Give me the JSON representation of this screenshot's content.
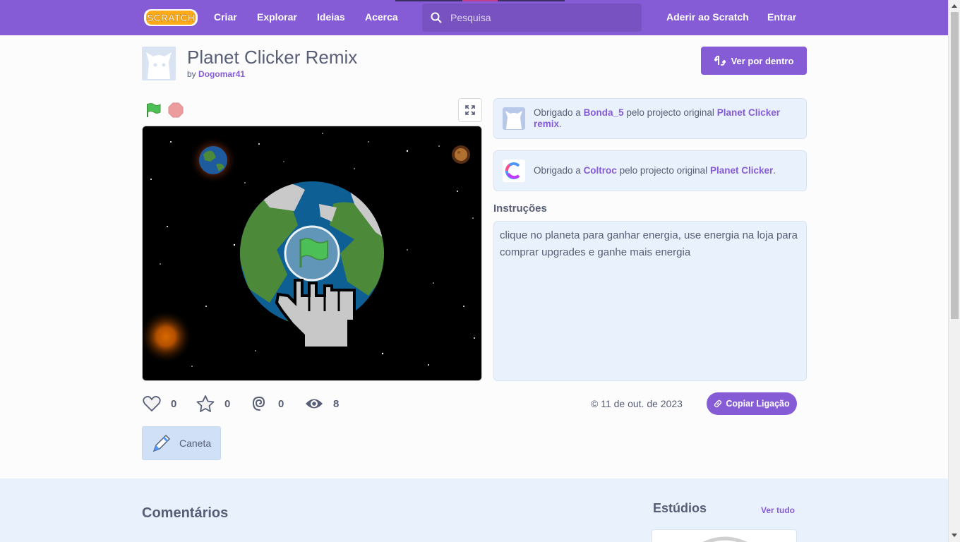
{
  "nav": {
    "logo_text": "SCRATCH",
    "links": [
      "Criar",
      "Explorar",
      "Ideias",
      "Acerca"
    ],
    "search_placeholder": "Pesquisa",
    "join": "Aderir ao Scratch",
    "signin": "Entrar"
  },
  "project": {
    "title": "Planet Clicker Remix",
    "by_prefix": "by",
    "author": "Dogomar41",
    "see_inside": "Ver por dentro"
  },
  "credits": [
    {
      "prefix": "Obrigado a",
      "user": "Bonda_5",
      "middle": "pelo projecto original",
      "project": "Planet Clicker remix",
      "suffix": "."
    },
    {
      "prefix": "Obrigado a",
      "user": "Coltroc",
      "middle": "pelo projecto original",
      "project": "Planet Clicker",
      "suffix": "."
    }
  ],
  "instructions": {
    "label": "Instruções",
    "text": "clique no planeta para ganhar energia, use energia na loja para comprar upgrades e ganhe mais energia"
  },
  "stats": {
    "loves": "0",
    "favorites": "0",
    "remixes": "0",
    "views": "8"
  },
  "date": "© 11 de out. de 2023",
  "copy_link": "Copiar Ligação",
  "tag": "Caneta",
  "bottom": {
    "comments": "Comentários",
    "studios": "Estúdios",
    "see_all": "Ver tudo"
  },
  "colors": {
    "brand": "#855cd6",
    "stage_bg": "#000000",
    "panel_bg": "#e9f1fc"
  },
  "icons": [
    "search-icon",
    "remix-icon",
    "green-flag-icon",
    "stop-icon",
    "fullscreen-icon",
    "heart-icon",
    "star-icon",
    "remix-spiral-icon",
    "eye-icon",
    "link-icon",
    "pen-icon"
  ]
}
